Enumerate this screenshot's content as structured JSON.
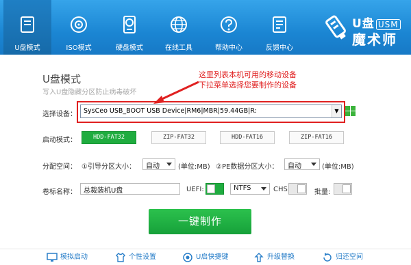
{
  "tabs": [
    {
      "label": "U盘模式",
      "icon": "usb-drive-icon"
    },
    {
      "label": "ISO模式",
      "icon": "disc-icon"
    },
    {
      "label": "硬盘模式",
      "icon": "hard-disk-icon"
    },
    {
      "label": "在线工具",
      "icon": "globe-icon"
    },
    {
      "label": "帮助中心",
      "icon": "help-icon"
    },
    {
      "label": "反馈中心",
      "icon": "feedback-icon"
    }
  ],
  "logo": {
    "line1": "U盘",
    "badge": "USM",
    "line2": "魔术师"
  },
  "main": {
    "title": "U盘模式",
    "subtitle": "写入U盘隐藏分区防止病毒破坏",
    "annotation": [
      "这里列表本机可用的移动设备",
      "下拉菜单选择您要制作的设备"
    ],
    "device_label": "选择设备：",
    "device_value": "SysCeo USB_BOOT USB Device|RM6|MBR|59.44GB|R:",
    "boot_mode_label": "启动模式：",
    "boot_modes": [
      "HDD-FAT32",
      "ZIP-FAT32",
      "HDD-FAT16",
      "ZIP-FAT16"
    ],
    "partition_label": "分配空间：",
    "partition1_label": "①引导分区大小：",
    "partition1_value": "自动",
    "partition1_unit": "(单位:MB)",
    "partition2_label": "②PE数据分区大小：",
    "partition2_value": "自动",
    "partition2_unit": "(单位:MB)",
    "volume_label": "卷标名称：",
    "volume_value": "总裁装机U盘",
    "uefi_label": "UEFI:",
    "fs_value": "NTFS",
    "chs_label": "CHS:",
    "batch_label": "批量:",
    "make_button": "一键制作"
  },
  "bottom": [
    {
      "label": "模拟启动",
      "icon": "monitor-icon"
    },
    {
      "label": "个性设置",
      "icon": "shirt-icon"
    },
    {
      "label": "U启快捷键",
      "icon": "target-icon"
    },
    {
      "label": "升级替换",
      "icon": "upgrade-icon"
    },
    {
      "label": "归还空间",
      "icon": "restore-icon"
    }
  ],
  "colors": {
    "toolbar": "#1b86d3",
    "accent_green": "#1fac3f",
    "annotation_red": "#e02020",
    "link_blue": "#2a7fc9"
  }
}
